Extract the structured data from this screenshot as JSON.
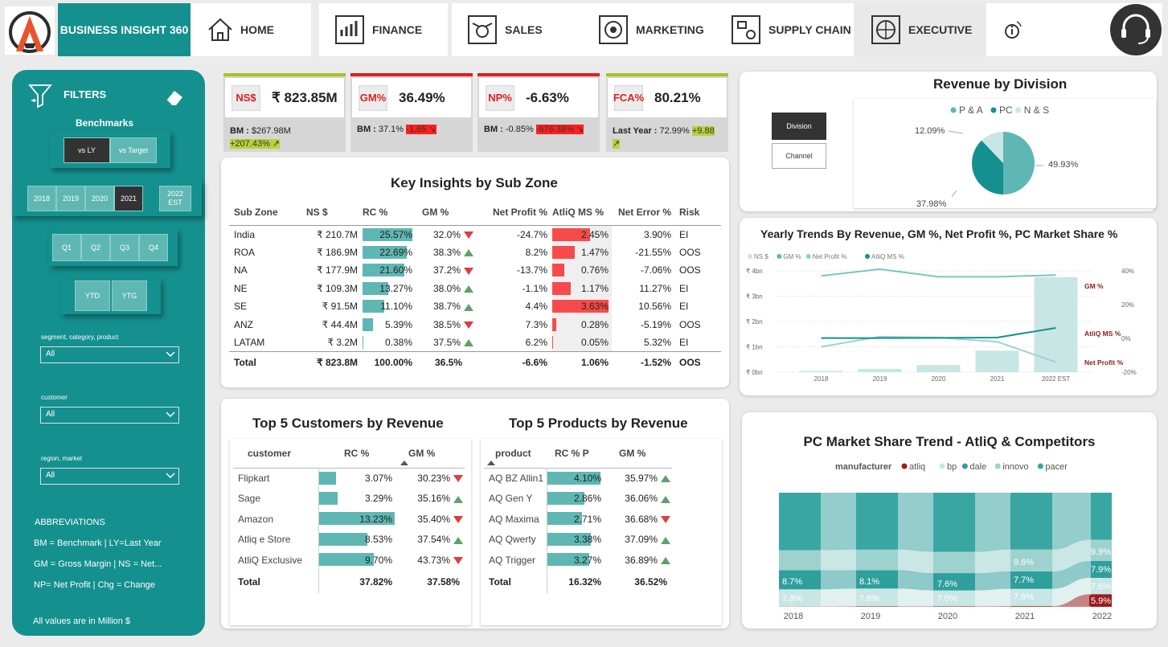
{
  "nav": {
    "brand": "BUSINESS INSIGHT 360",
    "items": [
      "HOME",
      "FINANCE",
      "SALES",
      "MARKETING",
      "SUPPLY CHAIN",
      "EXECUTIVE"
    ],
    "active": "EXECUTIVE"
  },
  "sidebar": {
    "filters_label": "FILTERS",
    "benchmarks_label": "Benchmarks",
    "bench_options": [
      "vs LY",
      "vs Target"
    ],
    "years": [
      "2018",
      "2019",
      "2020",
      "2021",
      "2022 EST"
    ],
    "selected_year": "2021",
    "quarters": [
      "Q1",
      "Q2",
      "Q3",
      "Q4"
    ],
    "ytd": [
      "YTD",
      "YTG"
    ],
    "dropdowns": [
      {
        "label": "segment, category, product",
        "value": "All"
      },
      {
        "label": "customer",
        "value": "All"
      },
      {
        "label": "region, market",
        "value": "All"
      }
    ],
    "abbr_title": "ABBREVIATIONS",
    "abbr_lines": [
      "BM = Benchmark | LY=Last Year",
      "GM = Gross Margin | NS = Net...",
      "NP= Net Profit | Chg = Change"
    ],
    "footer": "All values are in Million $"
  },
  "kpis": [
    {
      "label": "NS$",
      "value": "₹ 823.85M",
      "bm_label": "BM : ",
      "bm_value": "$267.98M",
      "chg": "+207.43%",
      "chg_type": "good",
      "arrow": "↗"
    },
    {
      "label": "GM%",
      "value": "36.49%",
      "bm_label": "BM : ",
      "bm_value": "37.1%",
      "chg": "-1.65",
      "chg_type": "bad",
      "arrow": "↘"
    },
    {
      "label": "NP%",
      "value": "-6.63%",
      "bm_label": "BM : ",
      "bm_value": "-0.85%",
      "chg": "-676.38%",
      "chg_type": "bad",
      "arrow": "↘"
    },
    {
      "label": "FCA%",
      "value": "80.21%",
      "bm_label": "Last Year : ",
      "bm_value": "72.99%",
      "chg": "+9.88",
      "chg_type": "good",
      "arrow": "↗"
    }
  ],
  "colors": {
    "teal": "#14908f",
    "light_teal": "#5fb7b3",
    "red": "#f74b4b",
    "atliq": "#9b1c1c"
  },
  "subzone": {
    "title": "Key Insights by Sub Zone",
    "headers": [
      "Sub Zone",
      "NS $",
      "RC %",
      "GM %",
      "Net Profit %",
      "AtliQ MS %",
      "Net Error %",
      "Risk"
    ],
    "rows": [
      {
        "zone": "India",
        "ns": "₹ 210.7M",
        "rc": "25.57%",
        "rc_v": 25.57,
        "gm": "32.0%",
        "gm_dir": "down",
        "np": "-24.7%",
        "ms": "2.45%",
        "ms_v": 2.45,
        "ne": "3.90%",
        "risk": "EI"
      },
      {
        "zone": "ROA",
        "ns": "₹ 186.9M",
        "rc": "22.69%",
        "rc_v": 22.69,
        "gm": "38.3%",
        "gm_dir": "up",
        "np": "8.2%",
        "ms": "1.47%",
        "ms_v": 1.47,
        "ne": "-21.55%",
        "risk": "OOS"
      },
      {
        "zone": "NA",
        "ns": "₹ 177.9M",
        "rc": "21.60%",
        "rc_v": 21.6,
        "gm": "37.2%",
        "gm_dir": "down",
        "np": "-13.7%",
        "ms": "0.76%",
        "ms_v": 0.76,
        "ne": "-7.06%",
        "risk": "OOS"
      },
      {
        "zone": "NE",
        "ns": "₹ 109.3M",
        "rc": "13.27%",
        "rc_v": 13.27,
        "gm": "38.0%",
        "gm_dir": "up",
        "np": "-1.1%",
        "ms": "1.17%",
        "ms_v": 1.17,
        "ne": "11.27%",
        "risk": "EI"
      },
      {
        "zone": "SE",
        "ns": "₹ 91.5M",
        "rc": "11.10%",
        "rc_v": 11.1,
        "gm": "38.7%",
        "gm_dir": "up",
        "np": "4.4%",
        "ms": "3.63%",
        "ms_v": 3.63,
        "ne": "10.56%",
        "risk": "EI"
      },
      {
        "zone": "ANZ",
        "ns": "₹ 44.4M",
        "rc": "5.39%",
        "rc_v": 5.39,
        "gm": "38.5%",
        "gm_dir": "down",
        "np": "7.3%",
        "ms": "0.28%",
        "ms_v": 0.28,
        "ne": "-5.19%",
        "risk": "OOS"
      },
      {
        "zone": "LATAM",
        "ns": "₹ 3.2M",
        "rc": "0.38%",
        "rc_v": 0.38,
        "gm": "37.5%",
        "gm_dir": "up",
        "np": "6.2%",
        "ms": "0.05%",
        "ms_v": 0.05,
        "ne": "5.32%",
        "risk": "EI"
      }
    ],
    "total": {
      "zone": "Total",
      "ns": "₹ 823.8M",
      "rc": "100.00%",
      "gm": "36.5%",
      "np": "-6.6%",
      "ms": "1.06%",
      "ne": "-1.52%",
      "risk": "OOS"
    }
  },
  "customers": {
    "title": "Top 5 Customers by Revenue",
    "headers": [
      "customer",
      "RC %",
      "GM %"
    ],
    "rows": [
      {
        "name": "Flipkart",
        "rc": "3.07%",
        "rc_v": 3.07,
        "gm": "30.23%",
        "dir": "down"
      },
      {
        "name": "Sage",
        "rc": "3.29%",
        "rc_v": 3.29,
        "gm": "35.16%",
        "dir": "up"
      },
      {
        "name": "Amazon",
        "rc": "13.23%",
        "rc_v": 13.23,
        "gm": "35.40%",
        "dir": "down"
      },
      {
        "name": "Atliq e Store",
        "rc": "8.53%",
        "rc_v": 8.53,
        "gm": "37.54%",
        "dir": "up"
      },
      {
        "name": "AtliQ Exclusive",
        "rc": "9.70%",
        "rc_v": 9.7,
        "gm": "43.73%",
        "dir": "down"
      }
    ],
    "total": {
      "name": "Total",
      "rc": "37.82%",
      "gm": "37.58%"
    }
  },
  "products": {
    "title": "Top 5 Products by Revenue",
    "headers": [
      "product",
      "RC % P",
      "GM %"
    ],
    "rows": [
      {
        "name": "AQ BZ Allin1",
        "rc": "4.10%",
        "rc_v": 4.1,
        "gm": "35.97%",
        "dir": "up"
      },
      {
        "name": "AQ Gen Y",
        "rc": "2.86%",
        "rc_v": 2.86,
        "gm": "36.06%",
        "dir": "up"
      },
      {
        "name": "AQ Maxima",
        "rc": "2.71%",
        "rc_v": 2.71,
        "gm": "36.68%",
        "dir": "down"
      },
      {
        "name": "AQ Qwerty",
        "rc": "3.38%",
        "rc_v": 3.38,
        "gm": "37.09%",
        "dir": "up"
      },
      {
        "name": "AQ Trigger",
        "rc": "3.27%",
        "rc_v": 3.27,
        "gm": "36.89%",
        "dir": "up"
      }
    ],
    "total": {
      "name": "Total",
      "rc": "16.32%",
      "gm": "36.52%"
    }
  },
  "revenue_division": {
    "title": "Revenue by Division",
    "toggles": [
      "Division",
      "Channel"
    ],
    "active_toggle": "Division"
  },
  "chart_data": [
    {
      "type": "pie",
      "title": "Revenue by Division",
      "categories": [
        "P & A",
        "PC",
        "N & S"
      ],
      "values": [
        49.93,
        37.98,
        12.09
      ],
      "labels": [
        "49.93%",
        "37.98%",
        "12.09%"
      ],
      "colors": [
        "#5fb7b3",
        "#14908f",
        "#c8e6e4"
      ],
      "legend": "top"
    },
    {
      "type": "bar",
      "title": "Yearly Trends By Revenue, GM %, Net Profit %, PC Market Share %",
      "categories": [
        "2018",
        "2019",
        "2020",
        "2021",
        "2022 EST"
      ],
      "series": [
        {
          "name": "NS $",
          "values": [
            0.05,
            0.13,
            0.28,
            0.85,
            3.75
          ],
          "axis": "left"
        },
        {
          "name": "GM %",
          "values": [
            37.0,
            41.0,
            36.5,
            36.5,
            37.5
          ],
          "axis": "right"
        },
        {
          "name": "Net Profit %",
          "values": [
            -5.0,
            1.0,
            0.5,
            -2.0,
            -14.0
          ],
          "axis": "right"
        },
        {
          "name": "AtliQ MS %",
          "values": [
            0.2,
            0.2,
            0.3,
            0.5,
            6.2
          ],
          "axis": "right"
        }
      ],
      "y_ticks": [
        "₹ 0bn",
        "₹ 1bn",
        "₹ 2bn",
        "₹ 3bn",
        "₹ 4bn"
      ],
      "ylim": [
        0,
        4
      ],
      "y2_ticks": [
        "-20%",
        "0%",
        "20%",
        "40%"
      ],
      "y2lim": [
        -20,
        40
      ],
      "line_labels": [
        "GM %",
        "AtliQ MS %",
        "Net Profit %"
      ],
      "legend": "top-left"
    },
    {
      "type": "area",
      "title": "PC Market Share Trend - AtliQ & Competitors",
      "legend_title": "manufacturer",
      "categories": [
        "2018",
        "2019",
        "2020",
        "2021",
        "2022"
      ],
      "series": [
        {
          "name": "atliq",
          "values": [
            0.1,
            0.2,
            0.2,
            0.3,
            5.9
          ],
          "color": "#9b1c1c"
        },
        {
          "name": "bp",
          "values": [
            7.8,
            7.8,
            7.0,
            7.6,
            7.6
          ],
          "color": "#c8e6e4"
        },
        {
          "name": "dale",
          "values": [
            8.7,
            8.1,
            7.6,
            7.7,
            7.9
          ],
          "color": "#2f9f9c"
        },
        {
          "name": "innovo",
          "values": [
            9.0,
            9.0,
            9.3,
            9.6,
            9.9
          ],
          "color": "#9ed2cf"
        },
        {
          "name": "pacer",
          "values": [
            26.0,
            25.0,
            26.0,
            25.0,
            22.0
          ],
          "color": "#3aa6a2"
        }
      ],
      "labels": {
        "2018": [
          "8.7%",
          "7.8%"
        ],
        "2019": [
          "8.1%",
          "7.8%"
        ],
        "2020": [
          "7.6%",
          "7.0%"
        ],
        "2021": [
          "9.6%",
          "7.7%",
          "7.6%"
        ],
        "2022": [
          "9.9%",
          "7.9%",
          "7.6%",
          "5.9%"
        ]
      },
      "legend": "top"
    }
  ]
}
